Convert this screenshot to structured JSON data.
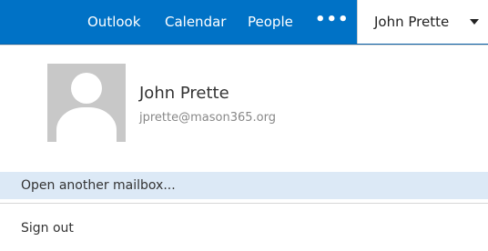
{
  "top_nav": {
    "items": [
      {
        "label": "Outlook"
      },
      {
        "label": "Calendar"
      },
      {
        "label": "People"
      }
    ],
    "more_label": "•••",
    "user_label": "John Prette",
    "user_chevron_icon": "chevron-down-icon"
  },
  "profile": {
    "name": "John Prette",
    "email": "jprette@mason365.org",
    "avatar_icon": "user-avatar-icon"
  },
  "menu": {
    "open_another_mailbox": "Open another mailbox...",
    "sign_out": "Sign out"
  },
  "colors": {
    "nav_bar": "#0072c6",
    "highlight": "#dce9f6"
  }
}
